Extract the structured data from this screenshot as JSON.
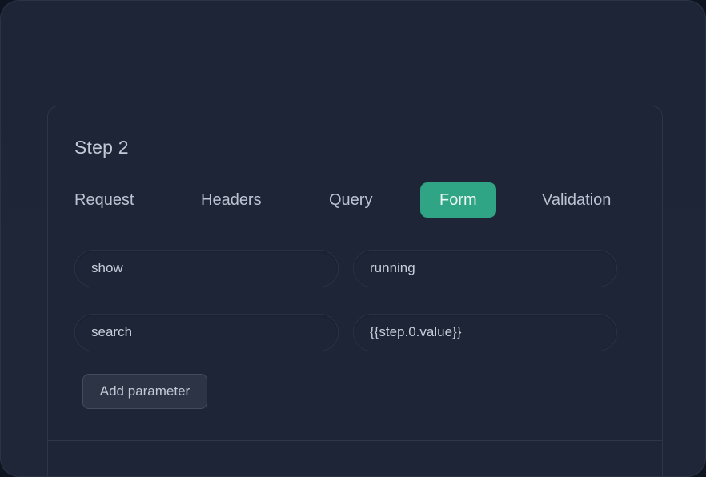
{
  "step": {
    "title": "Step 2"
  },
  "tabs": [
    {
      "label": "Request",
      "active": false
    },
    {
      "label": "Headers",
      "active": false
    },
    {
      "label": "Query",
      "active": false
    },
    {
      "label": "Form",
      "active": true
    },
    {
      "label": "Validation",
      "active": false
    }
  ],
  "params": [
    {
      "key": "show",
      "value": "running"
    },
    {
      "key": "search",
      "value": "{{step.0.value}}"
    }
  ],
  "add_button": {
    "label": "Add parameter"
  },
  "colors": {
    "background": "#1d2536",
    "accent": "#2fa585",
    "text": "#c1c9d6",
    "border": "#2d3648"
  }
}
